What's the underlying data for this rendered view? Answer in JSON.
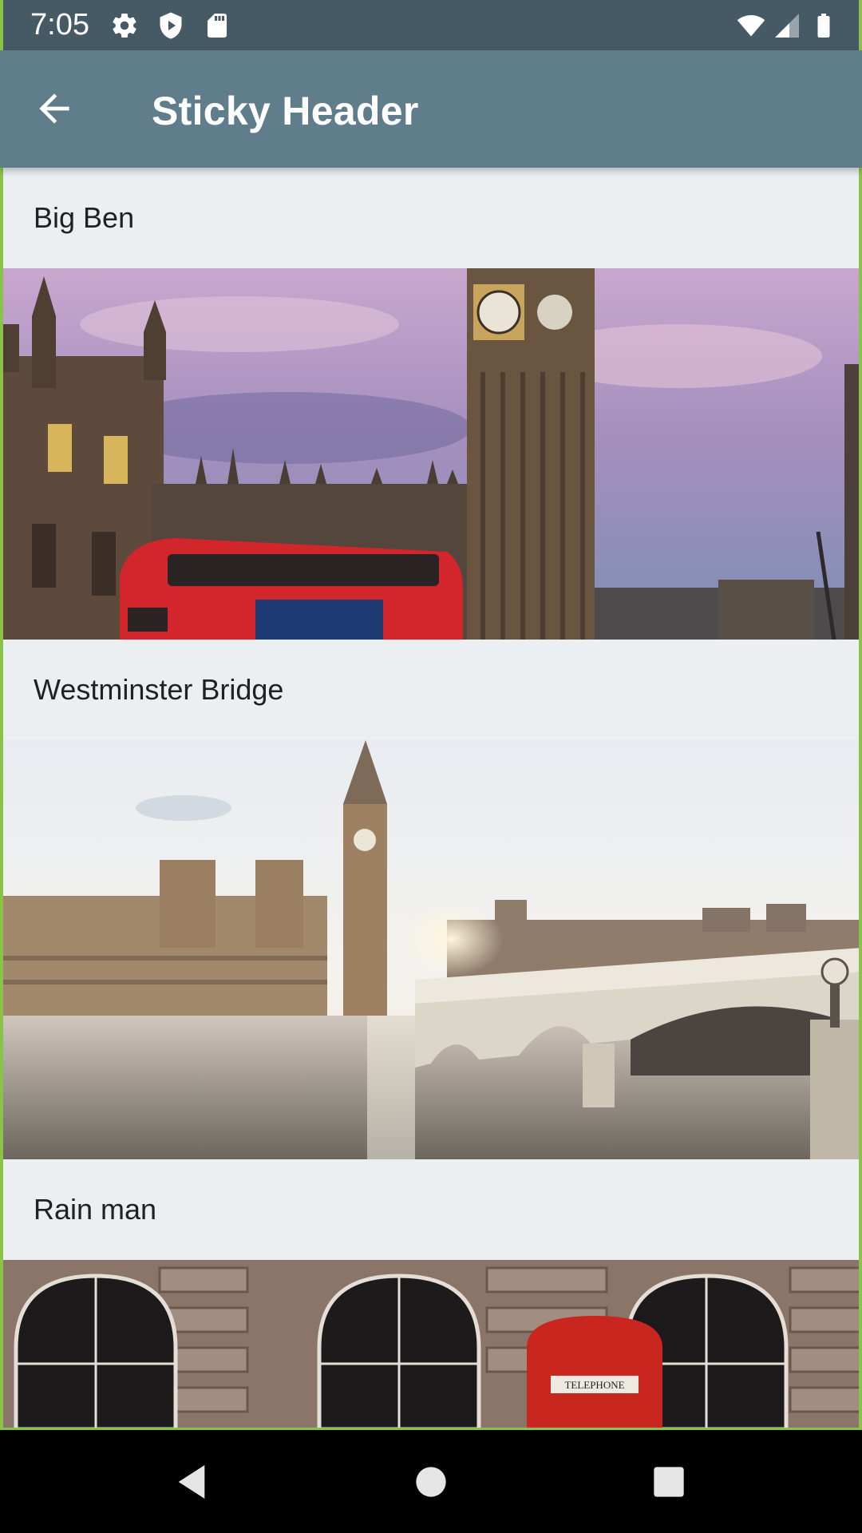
{
  "status_bar": {
    "time": "7:05",
    "left_icons": [
      "settings-icon",
      "shield-play-icon",
      "sd-card-icon"
    ],
    "right_icons": [
      "wifi-icon",
      "signal-icon",
      "battery-icon"
    ]
  },
  "app_bar": {
    "title": "Sticky Header",
    "back_icon": "arrow-back-icon"
  },
  "sections": [
    {
      "header": "Big Ben"
    },
    {
      "header": "Westminster Bridge"
    },
    {
      "header": "Rain man"
    }
  ],
  "nav_bar": {
    "buttons": [
      "back-triangle-icon",
      "home-circle-icon",
      "recents-square-icon"
    ]
  },
  "colors": {
    "status_bar": "#455a64",
    "app_bar": "#607d8b",
    "list_background": "#eceff1",
    "nav_bar": "#000000"
  }
}
